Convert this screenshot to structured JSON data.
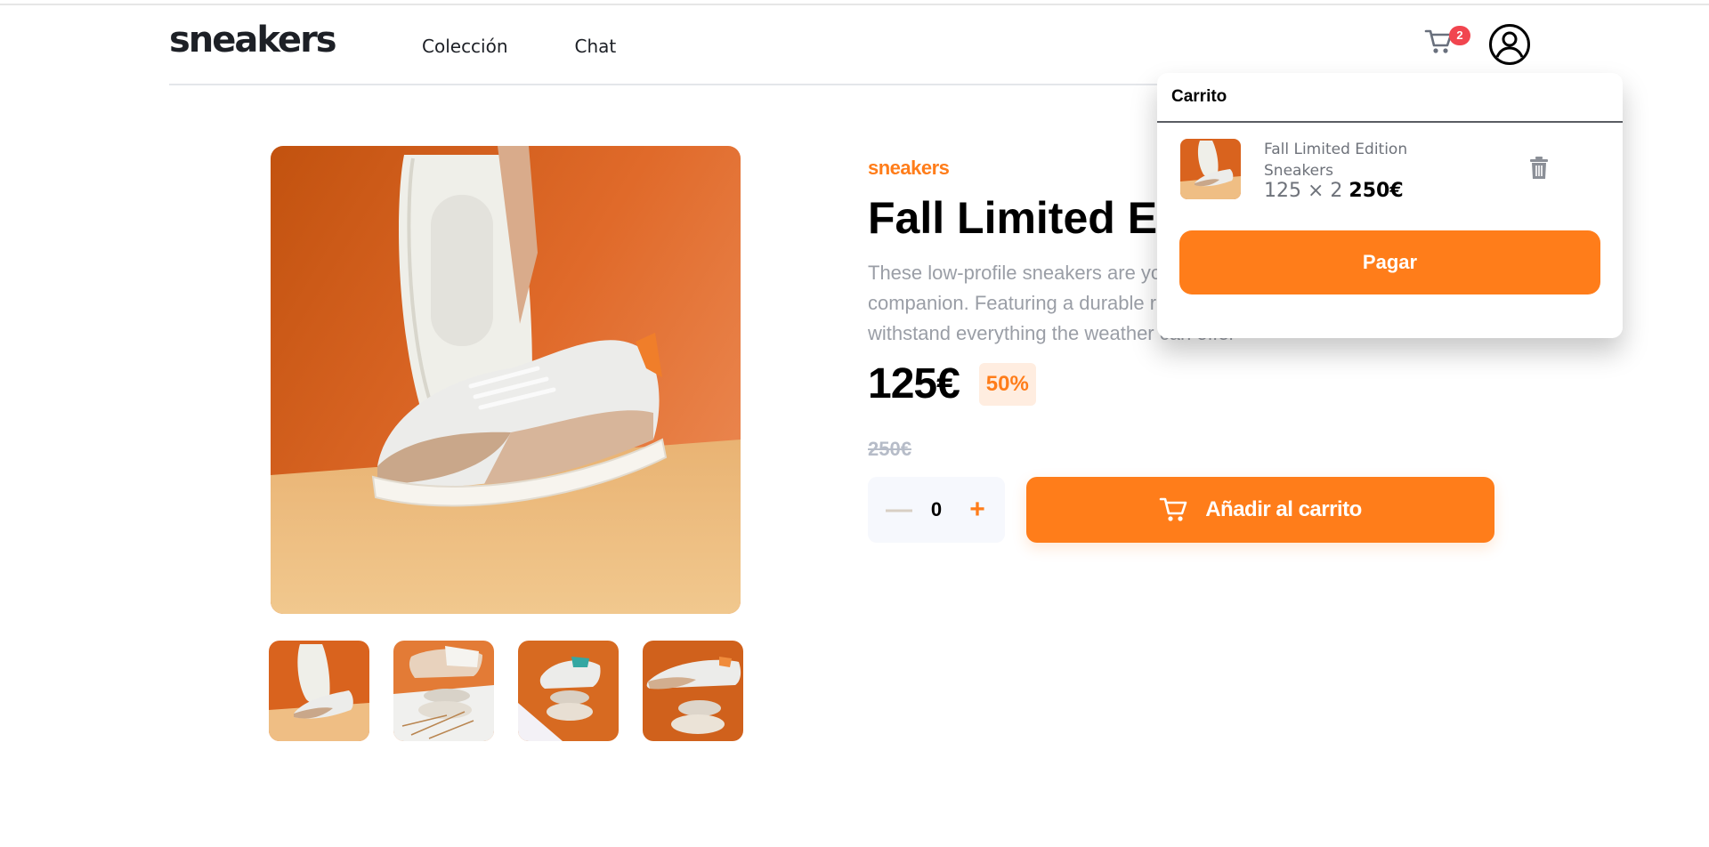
{
  "header": {
    "logo": "sneakers",
    "nav": [
      "Colección",
      "Chat"
    ],
    "cart_count": "2",
    "icons": {
      "cart": "cart-icon",
      "user": "user-avatar-icon"
    }
  },
  "product": {
    "company": "sneakers",
    "title": "Fall Limited Edition Sneakers",
    "description": "These low-profile sneakers are your perfect casual wear companion. Featuring a durable rubber outer sole, they'll withstand everything the weather can offer",
    "price": "125€",
    "discount": "50%",
    "old_price": "250€",
    "quantity": "0",
    "quantity_minus": "—",
    "quantity_plus": "+",
    "add_to_cart_label": "Añadir al carrito"
  },
  "cart": {
    "title": "Carrito",
    "items": [
      {
        "name": "Fall Limited Edition Sneakers",
        "unit_price": "125",
        "quantity": "2",
        "calc": "125 × 2",
        "total": "250€"
      }
    ],
    "checkout_label": "Pagar"
  },
  "colors": {
    "accent": "#ff7d1a",
    "accent_pale": "#ffede0",
    "badge": "#f1454f",
    "text_dark": "#1d2026",
    "text_muted": "#9a9ea6"
  }
}
